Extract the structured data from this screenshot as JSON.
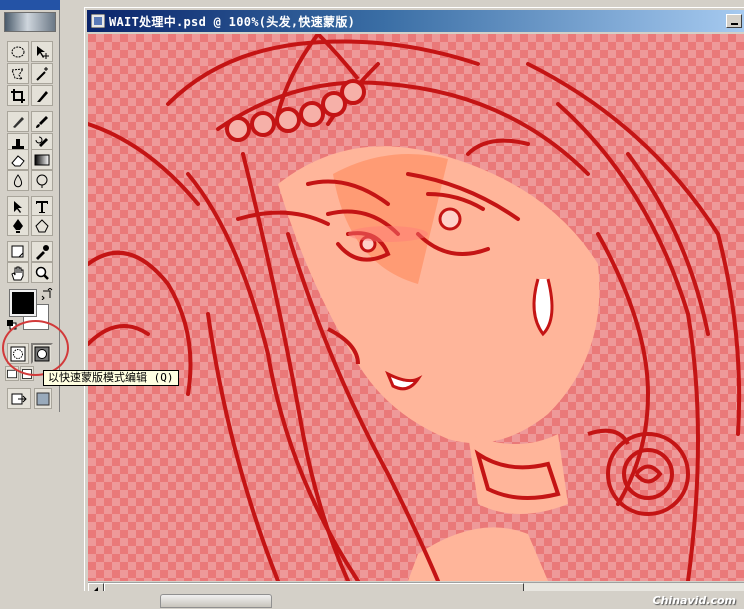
{
  "document": {
    "title": "WAIT处理中.psd @ 100%(头发,快速蒙版)"
  },
  "toolbox": {
    "tools": [
      {
        "name": "marquee-tool"
      },
      {
        "name": "move-tool"
      },
      {
        "name": "lasso-tool"
      },
      {
        "name": "magic-wand-tool"
      },
      {
        "name": "crop-tool"
      },
      {
        "name": "slice-tool"
      },
      {
        "name": "healing-brush-tool"
      },
      {
        "name": "brush-tool"
      },
      {
        "name": "clone-stamp-tool"
      },
      {
        "name": "history-brush-tool"
      },
      {
        "name": "eraser-tool"
      },
      {
        "name": "gradient-tool"
      },
      {
        "name": "blur-tool"
      },
      {
        "name": "dodge-tool"
      },
      {
        "name": "path-selection-tool"
      },
      {
        "name": "type-tool"
      },
      {
        "name": "pen-tool"
      },
      {
        "name": "shape-tool"
      },
      {
        "name": "notes-tool"
      },
      {
        "name": "eyedropper-tool"
      },
      {
        "name": "hand-tool"
      },
      {
        "name": "zoom-tool"
      }
    ],
    "foreground_color": "#000000",
    "background_color": "#ffffff"
  },
  "tooltip": {
    "text": "以快速蒙版模式编辑 (Q)"
  },
  "watermark": {
    "text": "Chinavid.com"
  },
  "colors": {
    "title_bar_start": "#0a246a",
    "title_bar_end": "#a6caf0",
    "quick_mask_overlay": "#e85a5a",
    "line_art": "#c41414",
    "skin": "#ffb59a",
    "highlight_circle": "#d23a3a"
  }
}
